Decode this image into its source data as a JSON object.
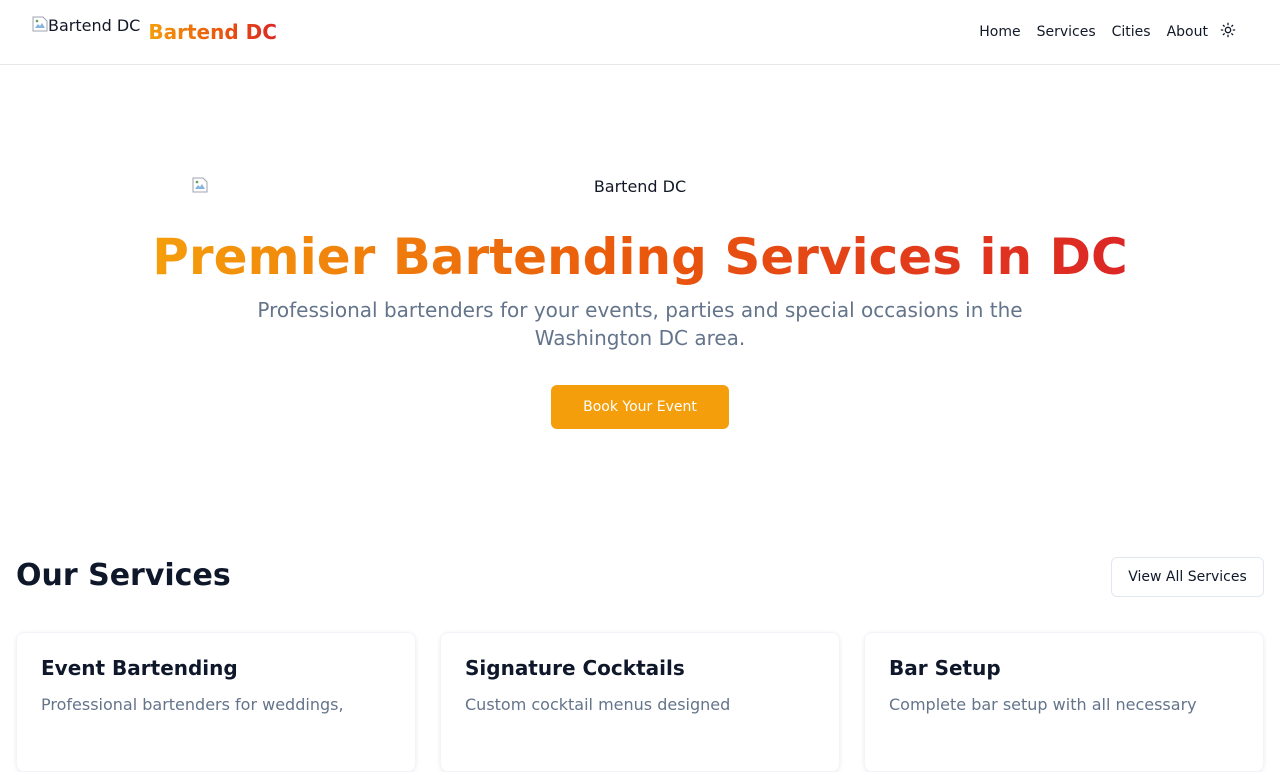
{
  "header": {
    "logo_alt": "Bartend DC",
    "brand_name": "Bartend DC",
    "nav": [
      {
        "label": "Home"
      },
      {
        "label": "Services"
      },
      {
        "label": "Cities"
      },
      {
        "label": "About"
      }
    ],
    "theme_toggle_icon": "sun-icon"
  },
  "hero": {
    "logo_alt": "Bartend DC",
    "title": "Premier Bartending Services in DC",
    "subtitle": "Professional bartenders for your events, parties and special occasions in the Washington DC area.",
    "cta_label": "Book Your Event"
  },
  "services": {
    "title": "Our Services",
    "view_all_label": "View All Services",
    "cards": [
      {
        "title": "Event Bartending",
        "description": "Professional bartenders for weddings,"
      },
      {
        "title": "Signature Cocktails",
        "description": "Custom cocktail menus designed"
      },
      {
        "title": "Bar Setup",
        "description": "Complete bar setup with all necessary"
      }
    ]
  },
  "colors": {
    "accent": "#f59e0b",
    "gradient_start": "#f59e0b",
    "gradient_end": "#dc2626",
    "muted_text": "#64748b"
  }
}
